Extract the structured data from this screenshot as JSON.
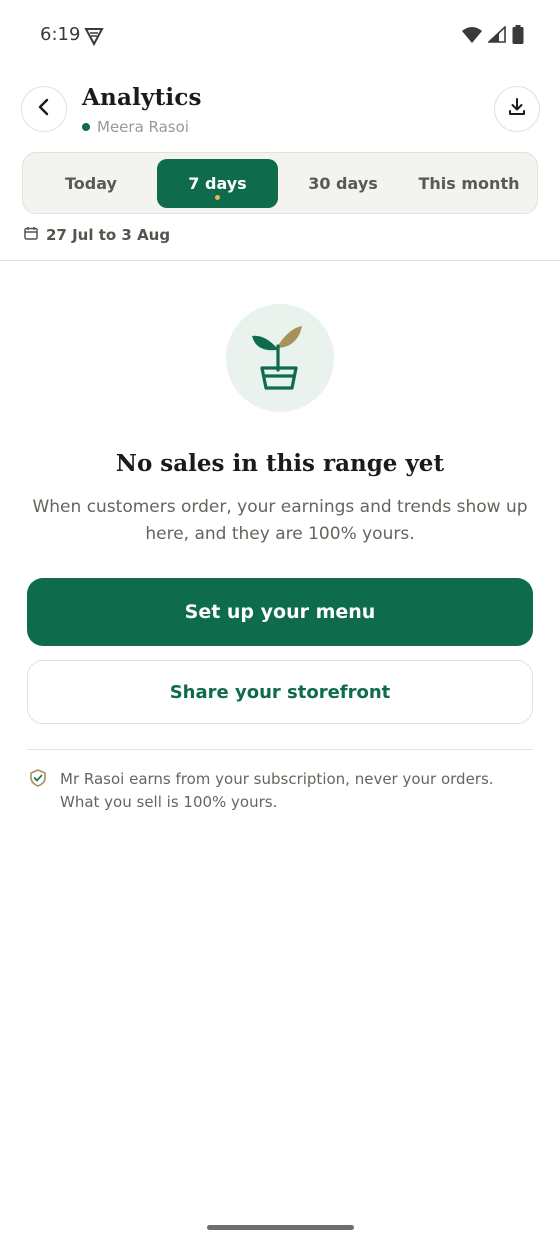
{
  "status_bar": {
    "time": "6:19"
  },
  "header": {
    "title": "Analytics",
    "subtitle": "Meera Rasoi",
    "accent": "#0e6b4c"
  },
  "tabs": [
    {
      "label": "Today",
      "active": false
    },
    {
      "label": "7 days",
      "active": true
    },
    {
      "label": "30 days",
      "active": false
    },
    {
      "label": "This month",
      "active": false
    }
  ],
  "date_range": "27 Jul to 3 Aug",
  "empty_state": {
    "title": "No sales in this range yet",
    "description": "When customers order, your earnings and trends show up here, and they are 100% yours.",
    "primary_button": "Set up your menu",
    "secondary_button": "Share your storefront"
  },
  "note": "Mr Rasoi earns from your subscription, never your orders. What you sell is 100% yours.",
  "colors": {
    "brand_green": "#0e6b4c",
    "active_dot": "#e6b94a",
    "leaf_tan": "#a8925a"
  },
  "icons": [
    "back-arrow-icon",
    "download-icon",
    "calendar-icon",
    "plant-icon",
    "shield-check-icon",
    "wifi-icon",
    "signal-icon",
    "battery-icon",
    "vpn-icon"
  ]
}
